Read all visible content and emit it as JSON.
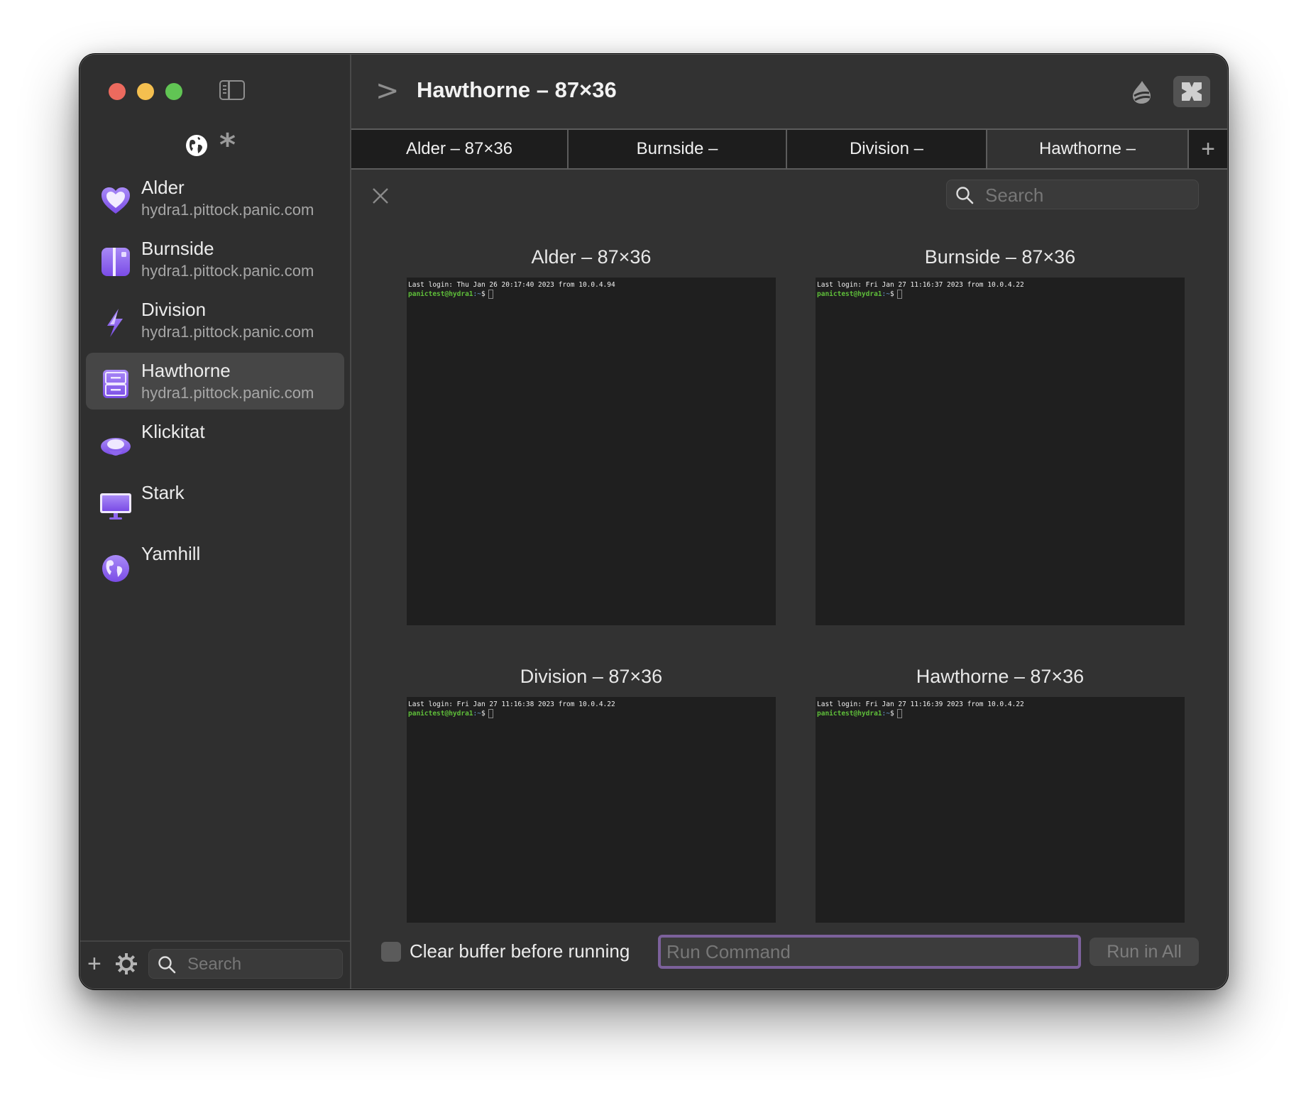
{
  "window": {
    "title": "Hawthorne – 87×36",
    "traffic_lights": {
      "close": "#ec6a5e",
      "minimize": "#f4bf4f",
      "zoom": "#61c554"
    }
  },
  "sidebar": {
    "filters": [
      "globe-icon",
      "asterisk-icon"
    ],
    "servers": [
      {
        "name": "Alder",
        "host": "hydra1.pittock.panic.com",
        "icon": "heart-icon",
        "active": false
      },
      {
        "name": "Burnside",
        "host": "hydra1.pittock.panic.com",
        "icon": "book-icon",
        "active": false
      },
      {
        "name": "Division",
        "host": "hydra1.pittock.panic.com",
        "icon": "bolt-icon",
        "active": false
      },
      {
        "name": "Hawthorne",
        "host": "hydra1.pittock.panic.com",
        "icon": "cabinet-icon",
        "active": true
      },
      {
        "name": "Klickitat",
        "host": "",
        "icon": "hat-icon",
        "active": false
      },
      {
        "name": "Stark",
        "host": "",
        "icon": "monitor-icon",
        "active": false
      },
      {
        "name": "Yamhill",
        "host": "",
        "icon": "globe-icon",
        "active": false
      }
    ],
    "search_placeholder": "Search"
  },
  "tabs": [
    {
      "label": "Alder – 87×36",
      "active": false
    },
    {
      "label": "Burnside –",
      "active": false
    },
    {
      "label": "Division –",
      "active": false
    },
    {
      "label": "Hawthorne –",
      "active": true
    }
  ],
  "search": {
    "placeholder": "Search"
  },
  "panes": [
    {
      "title": "Alder – 87×36",
      "last_login": "Last login: Thu Jan 26 20:17:40 2023 from 10.0.4.94",
      "user": "panictest@hydra1",
      "path": ":~",
      "symbol": "$"
    },
    {
      "title": "Burnside – 87×36",
      "last_login": "Last login: Fri Jan 27 11:16:37 2023 from 10.0.4.22",
      "user": "panictest@hydra1",
      "path": ":~",
      "symbol": "$"
    },
    {
      "title": "Division – 87×36",
      "last_login": "Last login: Fri Jan 27 11:16:38 2023 from 10.0.4.22",
      "user": "panictest@hydra1",
      "path": ":~",
      "symbol": "$"
    },
    {
      "title": "Hawthorne – 87×36",
      "last_login": "Last login: Fri Jan 27 11:16:39 2023 from 10.0.4.22",
      "user": "panictest@hydra1",
      "path": ":~",
      "symbol": "$"
    }
  ],
  "bottom": {
    "checkbox_label": "Clear buffer before running",
    "checkbox_checked": false,
    "command_placeholder": "Run Command",
    "run_button": "Run in All"
  },
  "colors": {
    "accent": "#7c619b",
    "icon_purple": "#8b5cf6"
  }
}
